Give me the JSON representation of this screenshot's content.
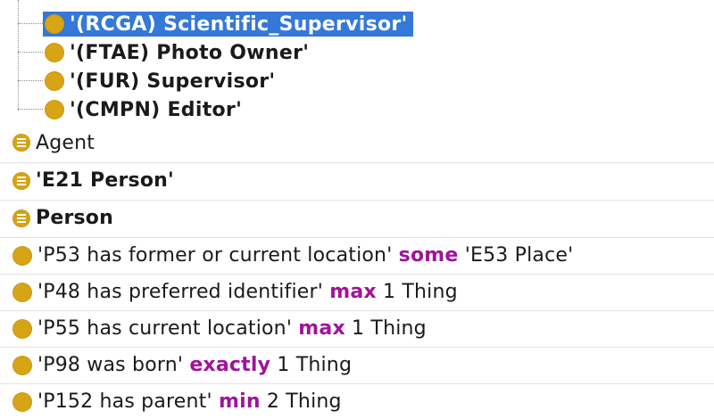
{
  "tree": {
    "children": [
      {
        "label": "'(RCGA) Scientific_Supervisor'",
        "selected": true
      },
      {
        "label": "'(FTAE) Photo Owner'",
        "selected": false
      },
      {
        "label": "'(FUR) Supervisor'",
        "selected": false
      },
      {
        "label": "'(CMPN) Editor'",
        "selected": false
      }
    ]
  },
  "classes": [
    {
      "label": "Agent",
      "bold": false
    },
    {
      "label": "'E21 Person'",
      "bold": true
    },
    {
      "label": "Person",
      "bold": true
    }
  ],
  "restrictions": [
    {
      "property": "'P53 has former or current location'",
      "keyword": "some",
      "filler": "'E53 Place'"
    },
    {
      "property": "'P48 has preferred identifier'",
      "keyword": "max",
      "filler": "1 Thing"
    },
    {
      "property": "'P55 has current location'",
      "keyword": "max",
      "filler": "1 Thing"
    },
    {
      "property": "'P98 was born'",
      "keyword": "exactly",
      "filler": "1 Thing"
    },
    {
      "property": "'P152 has parent'",
      "keyword": "min",
      "filler": "2 Thing"
    }
  ],
  "colors": {
    "selection": "#3478d8",
    "keyword": "#a0149a",
    "individual_dot": "#d7a415"
  },
  "icons": {
    "tree_node": "individual-dot-icon",
    "class": "equivalent-class-icon",
    "restriction": "superclass-dot-icon"
  }
}
